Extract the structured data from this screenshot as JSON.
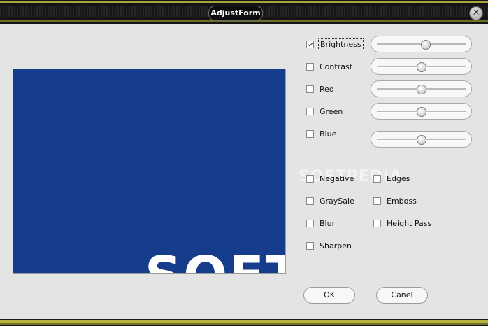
{
  "window": {
    "title": "AdjustForm"
  },
  "preview": {
    "text": "SOFT"
  },
  "adjustments": [
    {
      "label": "Brightness",
      "checked": true,
      "value": 0.55
    },
    {
      "label": "Contrast",
      "checked": false,
      "value": 0.5
    },
    {
      "label": "Red",
      "checked": false,
      "value": 0.5
    },
    {
      "label": "Green",
      "checked": false,
      "value": 0.5
    },
    {
      "label": "Blue",
      "checked": false,
      "value": 0.5
    }
  ],
  "filters": {
    "left": [
      {
        "label": "Negative",
        "checked": false
      },
      {
        "label": "GraySale",
        "checked": false
      },
      {
        "label": "Blur",
        "checked": false
      },
      {
        "label": "Sharpen",
        "checked": false
      }
    ],
    "right": [
      {
        "label": "Edges",
        "checked": false
      },
      {
        "label": "Emboss",
        "checked": false
      },
      {
        "label": "Height Pass",
        "checked": false
      }
    ]
  },
  "buttons": {
    "ok": "OK",
    "cancel": "Canel"
  },
  "watermark": "SOFTPEDIA",
  "close_icon": "close-icon"
}
